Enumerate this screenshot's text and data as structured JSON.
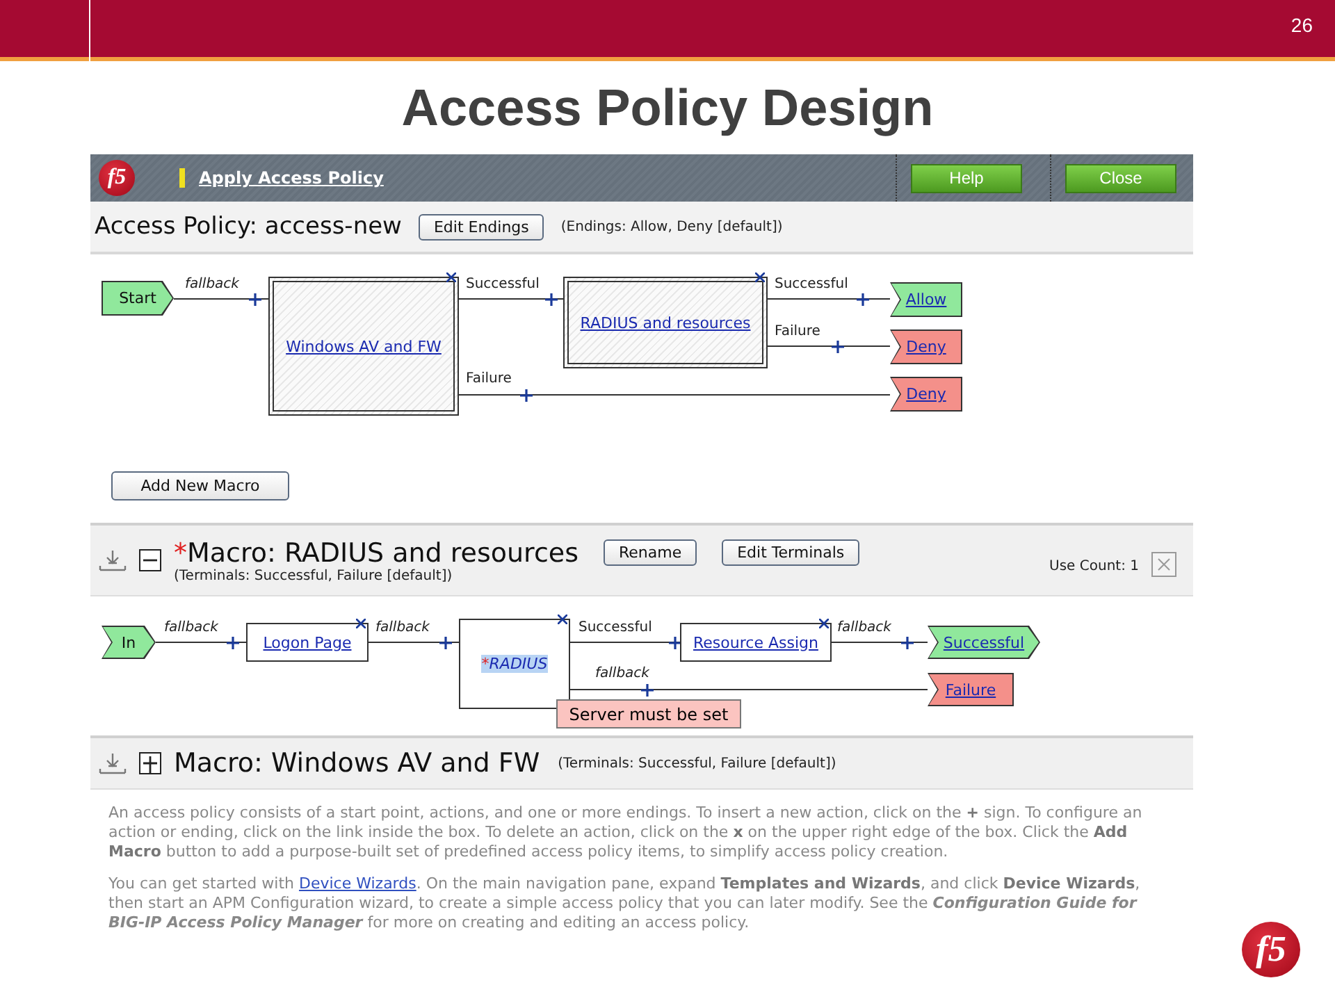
{
  "slide": {
    "page_number": "26",
    "title": "Access Policy Design",
    "logo": "f5"
  },
  "app": {
    "header": {
      "logo": "f5",
      "link": "Apply Access Policy",
      "buttons": [
        "Help",
        "Close"
      ]
    },
    "policy": {
      "title": "Access Policy: access-new",
      "button": "Edit Endings",
      "endings_note": "(Endings: Allow, Deny [default])",
      "nodes": [
        {
          "kind": "start",
          "label": "Start",
          "color": "#90e89c"
        },
        {
          "kind": "macro",
          "label": "Windows AV and FW"
        },
        {
          "kind": "macro",
          "label": "RADIUS and resources"
        },
        {
          "kind": "ending",
          "label": "Allow",
          "color": "#90e89c"
        },
        {
          "kind": "ending",
          "label": "Deny",
          "color": "#f4908a"
        },
        {
          "kind": "ending",
          "label": "Deny",
          "color": "#f4908a"
        }
      ],
      "branches": [
        {
          "label": "fallback",
          "italic": true
        },
        {
          "label": "Successful",
          "italic": false
        },
        {
          "label": "Successful",
          "italic": false
        },
        {
          "label": "Failure",
          "italic": false
        },
        {
          "label": "Failure",
          "italic": false
        }
      ],
      "add_button": "Add New Macro"
    },
    "macros": [
      {
        "expanded": true,
        "marker": "*",
        "title": "Macro: RADIUS and resources",
        "buttons": [
          "Rename",
          "Edit Terminals"
        ],
        "terminals": "(Terminals: Successful, Failure [default])",
        "use_count": "Use Count: 1",
        "nodes": [
          {
            "kind": "entry",
            "label": "In",
            "color": "#90e89c"
          },
          {
            "kind": "action",
            "label": "Logon Page"
          },
          {
            "kind": "action",
            "label": "RADIUS",
            "marker": "*"
          },
          {
            "kind": "action",
            "label": "Resource Assign"
          },
          {
            "kind": "exit",
            "label": "Successful",
            "color": "#90e89c"
          },
          {
            "kind": "ending",
            "label": "Failure",
            "color": "#f4908a"
          }
        ],
        "branches": [
          {
            "label": "fallback",
            "italic": true
          },
          {
            "label": "fallback",
            "italic": true
          },
          {
            "label": "Successful",
            "italic": false
          },
          {
            "label": "fallback",
            "italic": true
          },
          {
            "label": "fallback",
            "italic": true
          }
        ],
        "error": "Server must be set"
      },
      {
        "expanded": false,
        "title": "Macro: Windows AV and FW",
        "terminals": "(Terminals: Successful, Failure [default])"
      }
    ],
    "help": [
      {
        "parts": [
          {
            "text": "An access policy consists of a start point, actions, and one or more endings. To insert a new action, click on the **+** sign. To configure an action or ending, click on the link inside the box. To delete an action, click on the **x** on the upper right edge of the box. Click the **Add Macro** button to add a purpose-built set of predefined access policy items, to simplify access policy creation."
          }
        ]
      },
      {
        "parts": [
          {
            "text": "You can get started with "
          },
          {
            "link": "Device Wizards"
          },
          {
            "text": ". On the main navigation pane, expand **Templates and Wizards**, and click **Device Wizards**, then start an APM Configuration wizard, to create a simple access policy that you can later modify. See the *Configuration Guide for BIG-IP Access Policy Manager* for more on creating and editing an access policy."
          }
        ]
      }
    ]
  }
}
